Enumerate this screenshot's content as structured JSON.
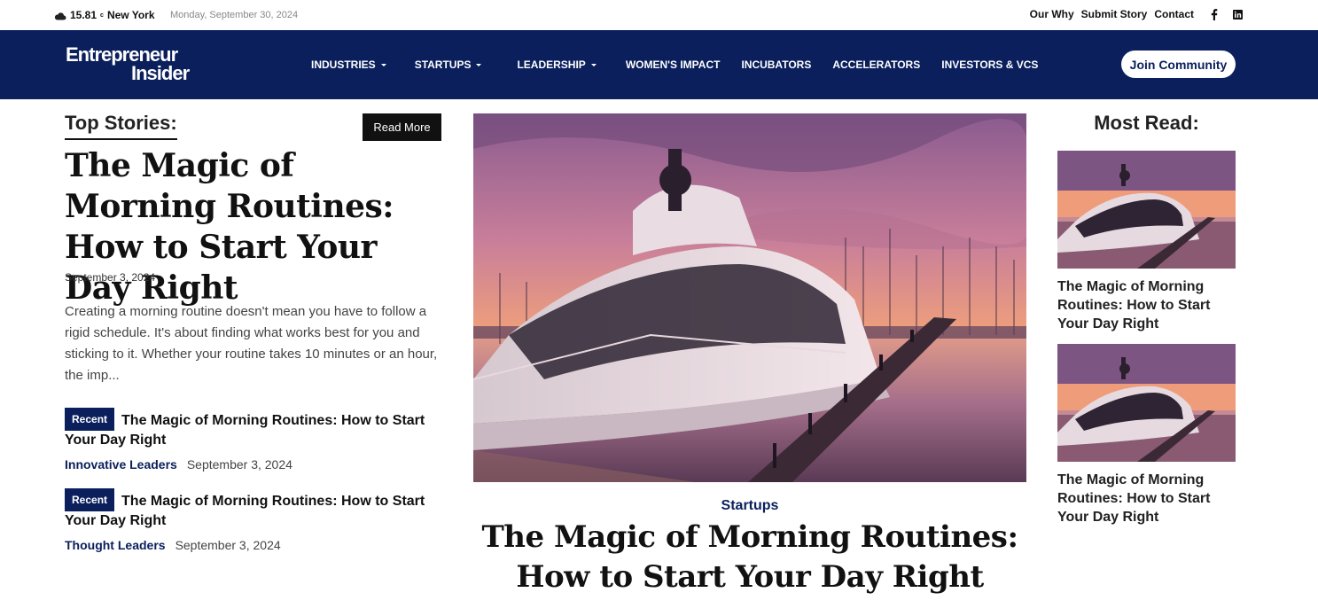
{
  "topbar": {
    "weather_temp": "15.81",
    "weather_unit": "c",
    "weather_city": "New York",
    "date": "Monday, September 30, 2024",
    "links": [
      "Our Why",
      "Submit Story",
      "Contact"
    ],
    "social": [
      "facebook-icon",
      "linkedin-icon"
    ]
  },
  "nav": {
    "logo_line1": "Entrepreneur",
    "logo_line2": "Insider",
    "items": [
      {
        "label": "INDUSTRIES",
        "dropdown": true
      },
      {
        "label": "STARTUPS",
        "dropdown": true
      },
      {
        "label": "LEADERSHIP",
        "dropdown": true
      },
      {
        "label": "WOMEN'S IMPACT",
        "dropdown": false
      },
      {
        "label": "INCUBATORS",
        "dropdown": false
      },
      {
        "label": "ACCELERATORS",
        "dropdown": false
      },
      {
        "label": "INVESTORS & VCS",
        "dropdown": false
      }
    ],
    "cta": "Join Community"
  },
  "top_stories": {
    "heading": "Top Stories:",
    "read_more": "Read More",
    "lead": {
      "title": "The Magic of Morning Routines: How to Start Your Day Right",
      "date": "September 3, 2024",
      "excerpt": "Creating a morning routine doesn't mean you have to follow a rigid schedule. It's about finding what works best for you and sticking to it. Whether your routine takes 10 minutes or an hour, the imp..."
    },
    "recent": [
      {
        "badge": "Recent",
        "title": "The Magic of Morning Routines: How to Start Your Day Right",
        "category": "Innovative Leaders",
        "date": "September 3, 2024"
      },
      {
        "badge": "Recent",
        "title": "The Magic of Morning Routines: How to Start Your Day Right",
        "category": "Thought Leaders",
        "date": "September 3, 2024"
      }
    ]
  },
  "featured": {
    "category": "Startups",
    "title": "The Magic of Morning Routines: How to Start Your Day Right"
  },
  "most_read": {
    "heading": "Most Read:",
    "items": [
      {
        "title": "The Magic of Morning Routines: How to Start Your Day Right"
      },
      {
        "title": "The Magic of Morning Routines: How to Start Your Day Right"
      }
    ]
  },
  "colors": {
    "brand_navy": "#0a1f5c",
    "black_button": "#111111"
  }
}
